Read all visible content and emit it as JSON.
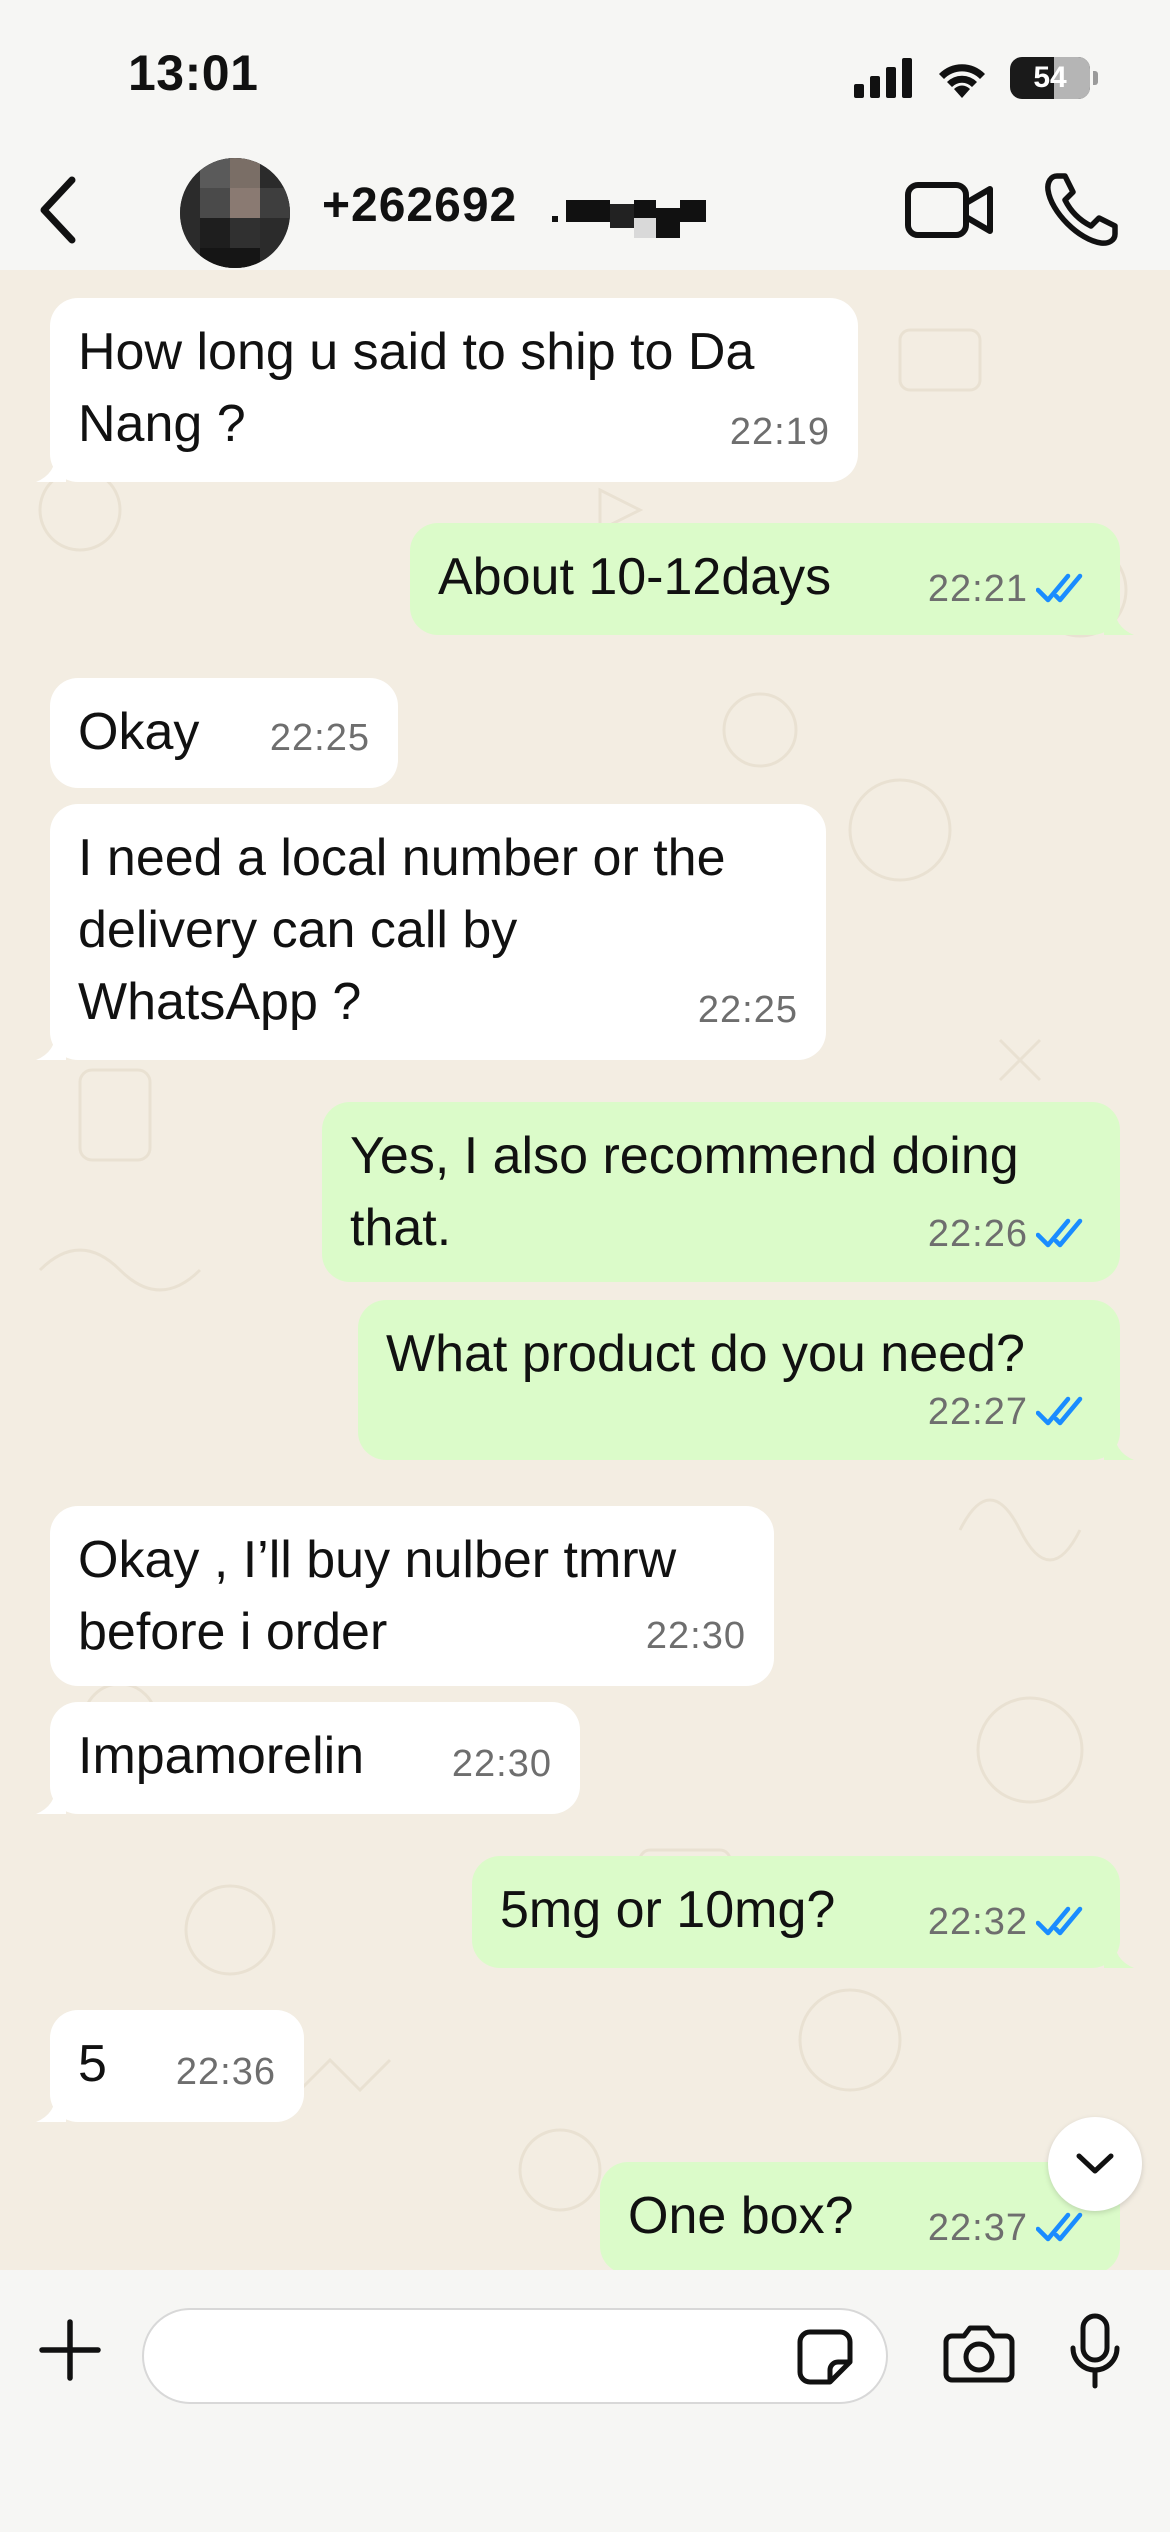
{
  "status_bar": {
    "time": "13:01",
    "battery": "54",
    "icons": [
      "signal-icon",
      "wifi-icon",
      "battery-icon"
    ]
  },
  "header": {
    "contact": "+262692",
    "icons": [
      "back-chevron-icon",
      "video-call-icon",
      "phone-call-icon"
    ]
  },
  "messages": [
    {
      "direction": "in",
      "lines": [
        "How long u said to ship to Da",
        "Nang ?"
      ],
      "time": "22:19"
    },
    {
      "direction": "out",
      "lines": [
        "About 10-12days"
      ],
      "time": "22:21",
      "read": true
    },
    {
      "direction": "in",
      "lines": [
        "Okay"
      ],
      "time": "22:25"
    },
    {
      "direction": "in",
      "lines": [
        "I need a local number or the",
        "delivery can call by",
        "WhatsApp ?"
      ],
      "time": "22:25"
    },
    {
      "direction": "out",
      "lines": [
        "Yes, I also recommend doing",
        "that."
      ],
      "time": "22:26",
      "read": true
    },
    {
      "direction": "out",
      "lines": [
        "What product do you need?"
      ],
      "time": "22:27",
      "read": true
    },
    {
      "direction": "in",
      "lines": [
        "Okay , I’ll buy nulber tmrw",
        "before i order"
      ],
      "time": "22:30"
    },
    {
      "direction": "in",
      "lines": [
        "Impamorelin"
      ],
      "time": "22:30"
    },
    {
      "direction": "out",
      "lines": [
        "5mg or 10mg?"
      ],
      "time": "22:32",
      "read": true
    },
    {
      "direction": "in",
      "lines": [
        "5"
      ],
      "time": "22:36"
    },
    {
      "direction": "out",
      "lines": [
        "One box?"
      ],
      "time": "22:37",
      "read": true
    }
  ],
  "composer": {
    "placeholder": "",
    "icons": [
      "plus-icon",
      "sticker-icon",
      "camera-icon",
      "microphone-icon"
    ]
  },
  "colors": {
    "incoming_bubble": "#ffffff",
    "outgoing_bubble": "#dbfbc9",
    "read_tick": "#1a8cff",
    "chat_background": "#f3ede2"
  }
}
